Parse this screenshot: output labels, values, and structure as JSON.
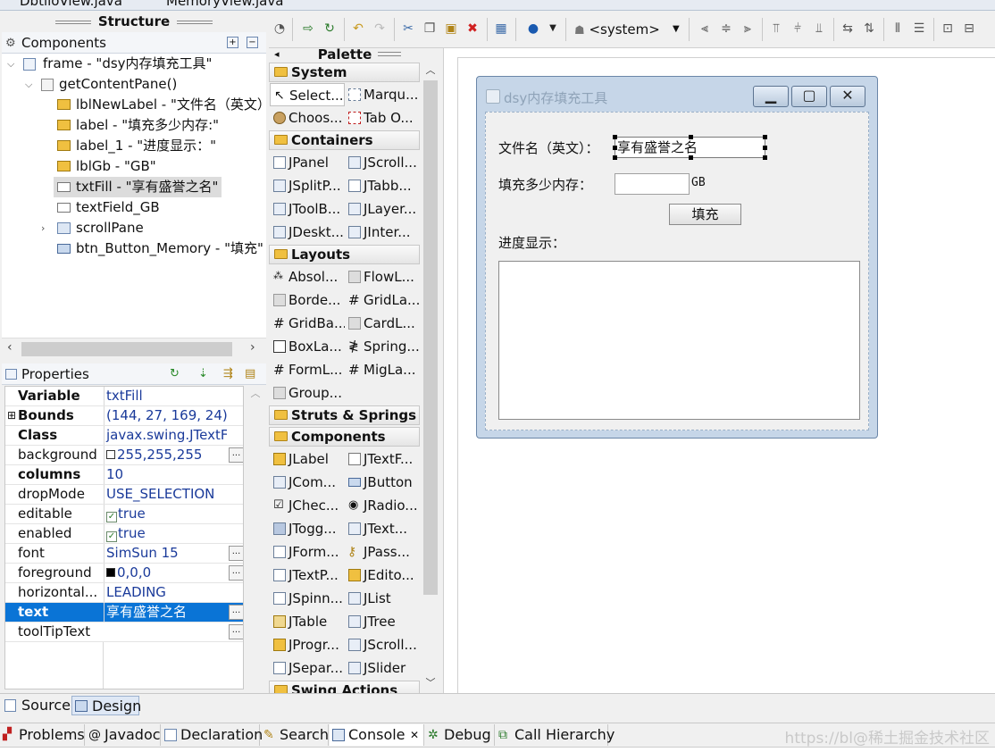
{
  "editor_tabs": [
    "DbtiloView.java",
    "MemoryView.java"
  ],
  "structure": {
    "title": "Structure",
    "components_label": "Components",
    "tree": [
      {
        "label": "frame - \"dsy内存填充工具\"",
        "icon": "frame-icon"
      },
      {
        "label": "getContentPane()",
        "icon": "panel-icon"
      },
      {
        "label": "lblNewLabel - \"文件名（英文）",
        "icon": "label-icon"
      },
      {
        "label": "label - \"填充多少内存:\"",
        "icon": "label-icon"
      },
      {
        "label": "label_1 - \"进度显示：\"",
        "icon": "label-icon"
      },
      {
        "label": "lblGb - \"GB\"",
        "icon": "label-icon"
      },
      {
        "label": "txtFill - \"享有盛誉之名\"",
        "icon": "textfield-icon"
      },
      {
        "label": "textField_GB",
        "icon": "textfield-icon"
      },
      {
        "label": "scrollPane",
        "icon": "scrollpane-icon"
      },
      {
        "label": "btn_Button_Memory - \"填充\"",
        "icon": "button-icon"
      }
    ]
  },
  "properties": {
    "title": "Properties",
    "rows": [
      {
        "name": "Variable",
        "value": "txtFill"
      },
      {
        "name": "Bounds",
        "value": "(144, 27, 169, 24)"
      },
      {
        "name": "Class",
        "value": "javax.swing.JTextFie..."
      },
      {
        "name": "background",
        "value": "255,255,255"
      },
      {
        "name": "columns",
        "value": "10"
      },
      {
        "name": "dropMode",
        "value": "USE_SELECTION"
      },
      {
        "name": "editable",
        "value": "true"
      },
      {
        "name": "enabled",
        "value": "true"
      },
      {
        "name": "font",
        "value": "SimSun 15"
      },
      {
        "name": "foreground",
        "value": "0,0,0"
      },
      {
        "name": "horizontal...",
        "value": "LEADING"
      },
      {
        "name": "text",
        "value": "享有盛誉之名"
      },
      {
        "name": "toolTipText",
        "value": ""
      }
    ]
  },
  "toolbar": {
    "system_combo": "<system>"
  },
  "palette": {
    "title": "Palette",
    "categories": {
      "system": "System",
      "containers": "Containers",
      "layouts": "Layouts",
      "struts": "Struts & Springs",
      "components": "Components",
      "swing_actions": "Swing Actions"
    },
    "system_items": [
      "Select...",
      "Marqu...",
      "Choos...",
      "Tab O..."
    ],
    "container_items": [
      "JPanel",
      "JScroll...",
      "JSplitP...",
      "JTabb...",
      "JToolB...",
      "JLayer...",
      "JDeskt...",
      "JInter..."
    ],
    "layout_items": [
      "Absol...",
      "FlowL...",
      "Borde...",
      "GridLa...",
      "GridBa...",
      "CardL...",
      "BoxLa...",
      "Spring...",
      "FormL...",
      "MigLa...",
      "Group..."
    ],
    "component_items": [
      "JLabel",
      "JTextF...",
      "JCom...",
      "JButton",
      "JChec...",
      "JRadio...",
      "JTogg...",
      "JText...",
      "JForm...",
      "JPass...",
      "JTextP...",
      "JEdito...",
      "JSpinn...",
      "JList",
      "JTable",
      "JTree",
      "JProgr...",
      "JScroll...",
      "JSepar...",
      "JSlider"
    ]
  },
  "design": {
    "frame_title": "dsy内存填充工具",
    "label_filename": "文件名（英文）：",
    "txt_fill_value": "享有盛誉之名",
    "label_memory": "填充多少内存：",
    "label_gb": "GB",
    "button_fill": "填充",
    "label_progress": "进度显示："
  },
  "mode_tabs": [
    "Source",
    "Design"
  ],
  "bottom_tabs": [
    "Problems",
    "Javadoc",
    "Declaration",
    "Search",
    "Console",
    "Debug",
    "Call Hierarchy"
  ],
  "watermark": "https://bl@稀土掘金技术社区",
  "colors": {
    "selection": "#0a74d6",
    "frame_border": "#6a86a8",
    "value_text": "#1a3a9a"
  }
}
